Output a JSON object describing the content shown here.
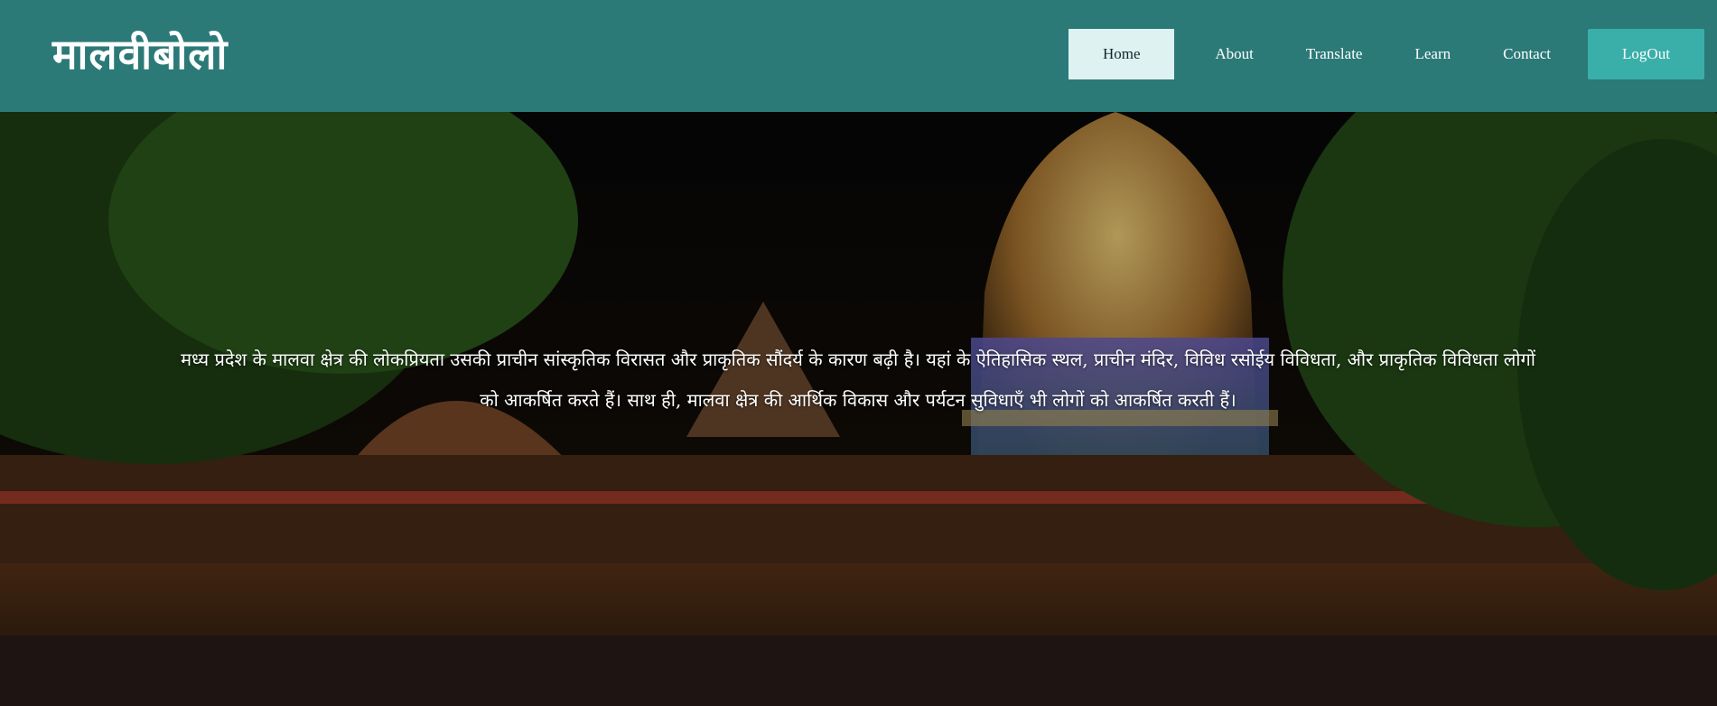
{
  "brand": {
    "title": "मालवीबोलो"
  },
  "nav": {
    "items": [
      {
        "label": "Home"
      },
      {
        "label": "About"
      },
      {
        "label": "Translate"
      },
      {
        "label": "Learn"
      },
      {
        "label": "Contact"
      }
    ],
    "logout_label": "LogOut"
  },
  "hero": {
    "image": "temple-night-illuminated",
    "paragraph": "मध्य प्रदेश के मालवा क्षेत्र की लोकप्रियता उसकी प्राचीन सांस्कृतिक विरासत और प्राकृतिक सौंदर्य के कारण बढ़ी है। यहां के ऐतिहासिक स्थल, प्राचीन मंदिर, विविध रसोईय विविधता, और प्राकृतिक विविधता लोगों को आकर्षित करते हैं। साथ ही, मालवा क्षेत्र की आर्थिक विकास और पर्यटन सुविधाएँ भी लोगों को आकर्षित करती हैं।"
  },
  "colors": {
    "navbar": "#2b7a78",
    "home_bg": "#def2f1",
    "logout_bg": "#3aafa9"
  }
}
